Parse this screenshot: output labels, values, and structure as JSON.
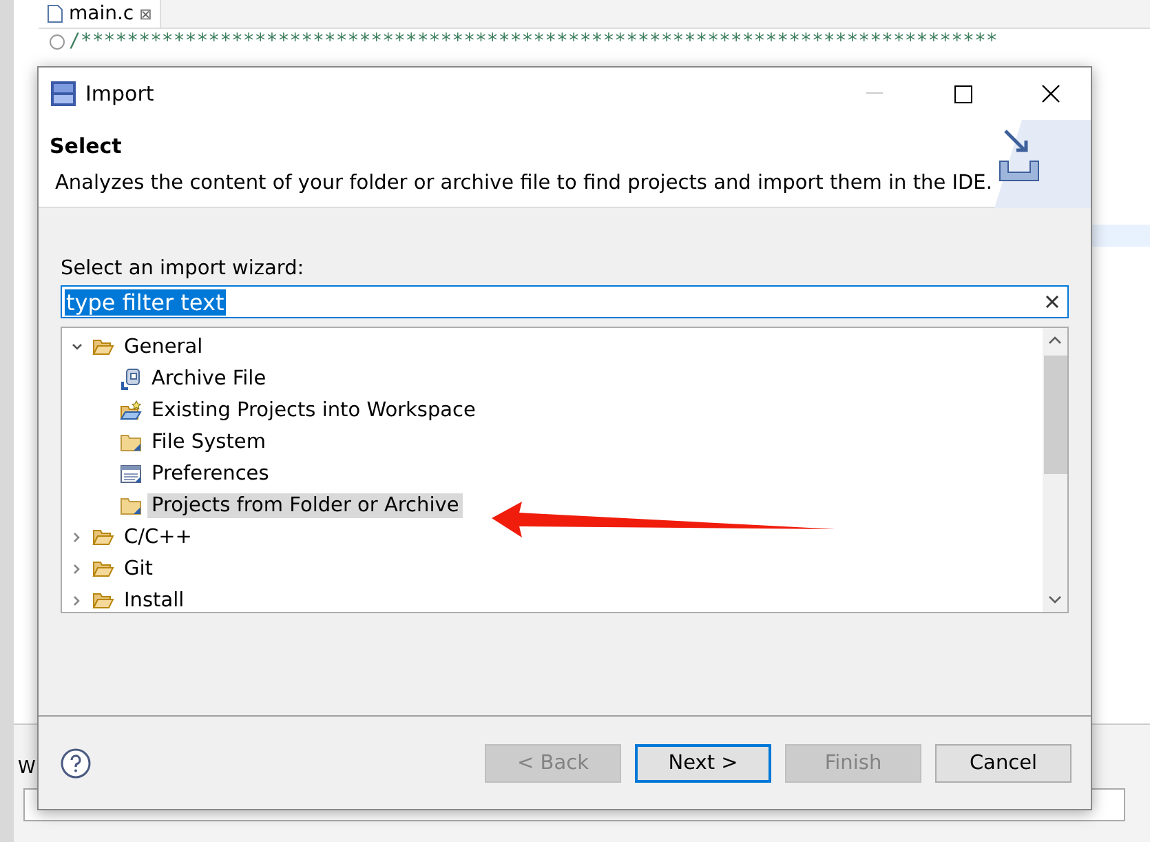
{
  "editor": {
    "tab": {
      "label": "main.c",
      "close": "⊠"
    },
    "code_line": "/*******************************************************************************",
    "view_letter": "W"
  },
  "dialog": {
    "title": "Import",
    "header": {
      "title": "Select",
      "description": "Analyzes the content of your folder or archive file to find projects and import them in the IDE."
    },
    "wizard_label": "Select an import wizard:",
    "filter": {
      "value": "type filter text"
    },
    "tree": [
      {
        "label": "General",
        "kind": "folder",
        "expanded": true,
        "selected": false,
        "children": [
          {
            "label": "Archive File",
            "kind": "archive",
            "selected": false
          },
          {
            "label": "Existing Projects into Workspace",
            "kind": "project",
            "selected": false
          },
          {
            "label": "File System",
            "kind": "location",
            "selected": false
          },
          {
            "label": "Preferences",
            "kind": "preferences",
            "selected": false
          },
          {
            "label": "Projects from Folder or Archive",
            "kind": "location",
            "selected": true
          }
        ]
      },
      {
        "label": "C/C++",
        "kind": "folder",
        "expanded": false,
        "selected": false
      },
      {
        "label": "Git",
        "kind": "folder",
        "expanded": false,
        "selected": false
      },
      {
        "label": "Install",
        "kind": "folder",
        "expanded": false,
        "selected": false
      }
    ],
    "buttons": [
      {
        "label": "< Back",
        "disabled": true,
        "default": false
      },
      {
        "label": "Next >",
        "disabled": false,
        "default": true
      },
      {
        "label": "Finish",
        "disabled": true,
        "default": false
      },
      {
        "label": "Cancel",
        "disabled": false,
        "default": false
      }
    ]
  }
}
